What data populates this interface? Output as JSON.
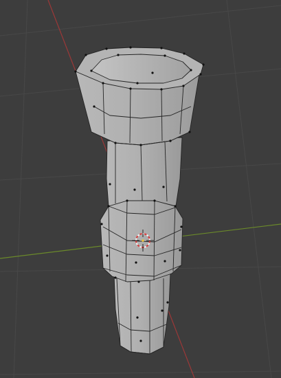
{
  "viewport": {
    "background": "#3d3d3d",
    "grid_color": "#4a4a4a",
    "x_axis_color": "#a33a3a",
    "y_axis_color": "#6f8a2a",
    "mode": "edit-mode-vertex-select"
  },
  "object": {
    "shape": "octagonal-tower",
    "segments": 8,
    "face_color": "#a9a9a9",
    "edge_color": "#202020",
    "vertex_color": "#111111"
  },
  "cursor": {
    "icon": "3d-cursor-icon",
    "ring_colors": [
      "#d83a3a",
      "#f2f2f2"
    ]
  }
}
